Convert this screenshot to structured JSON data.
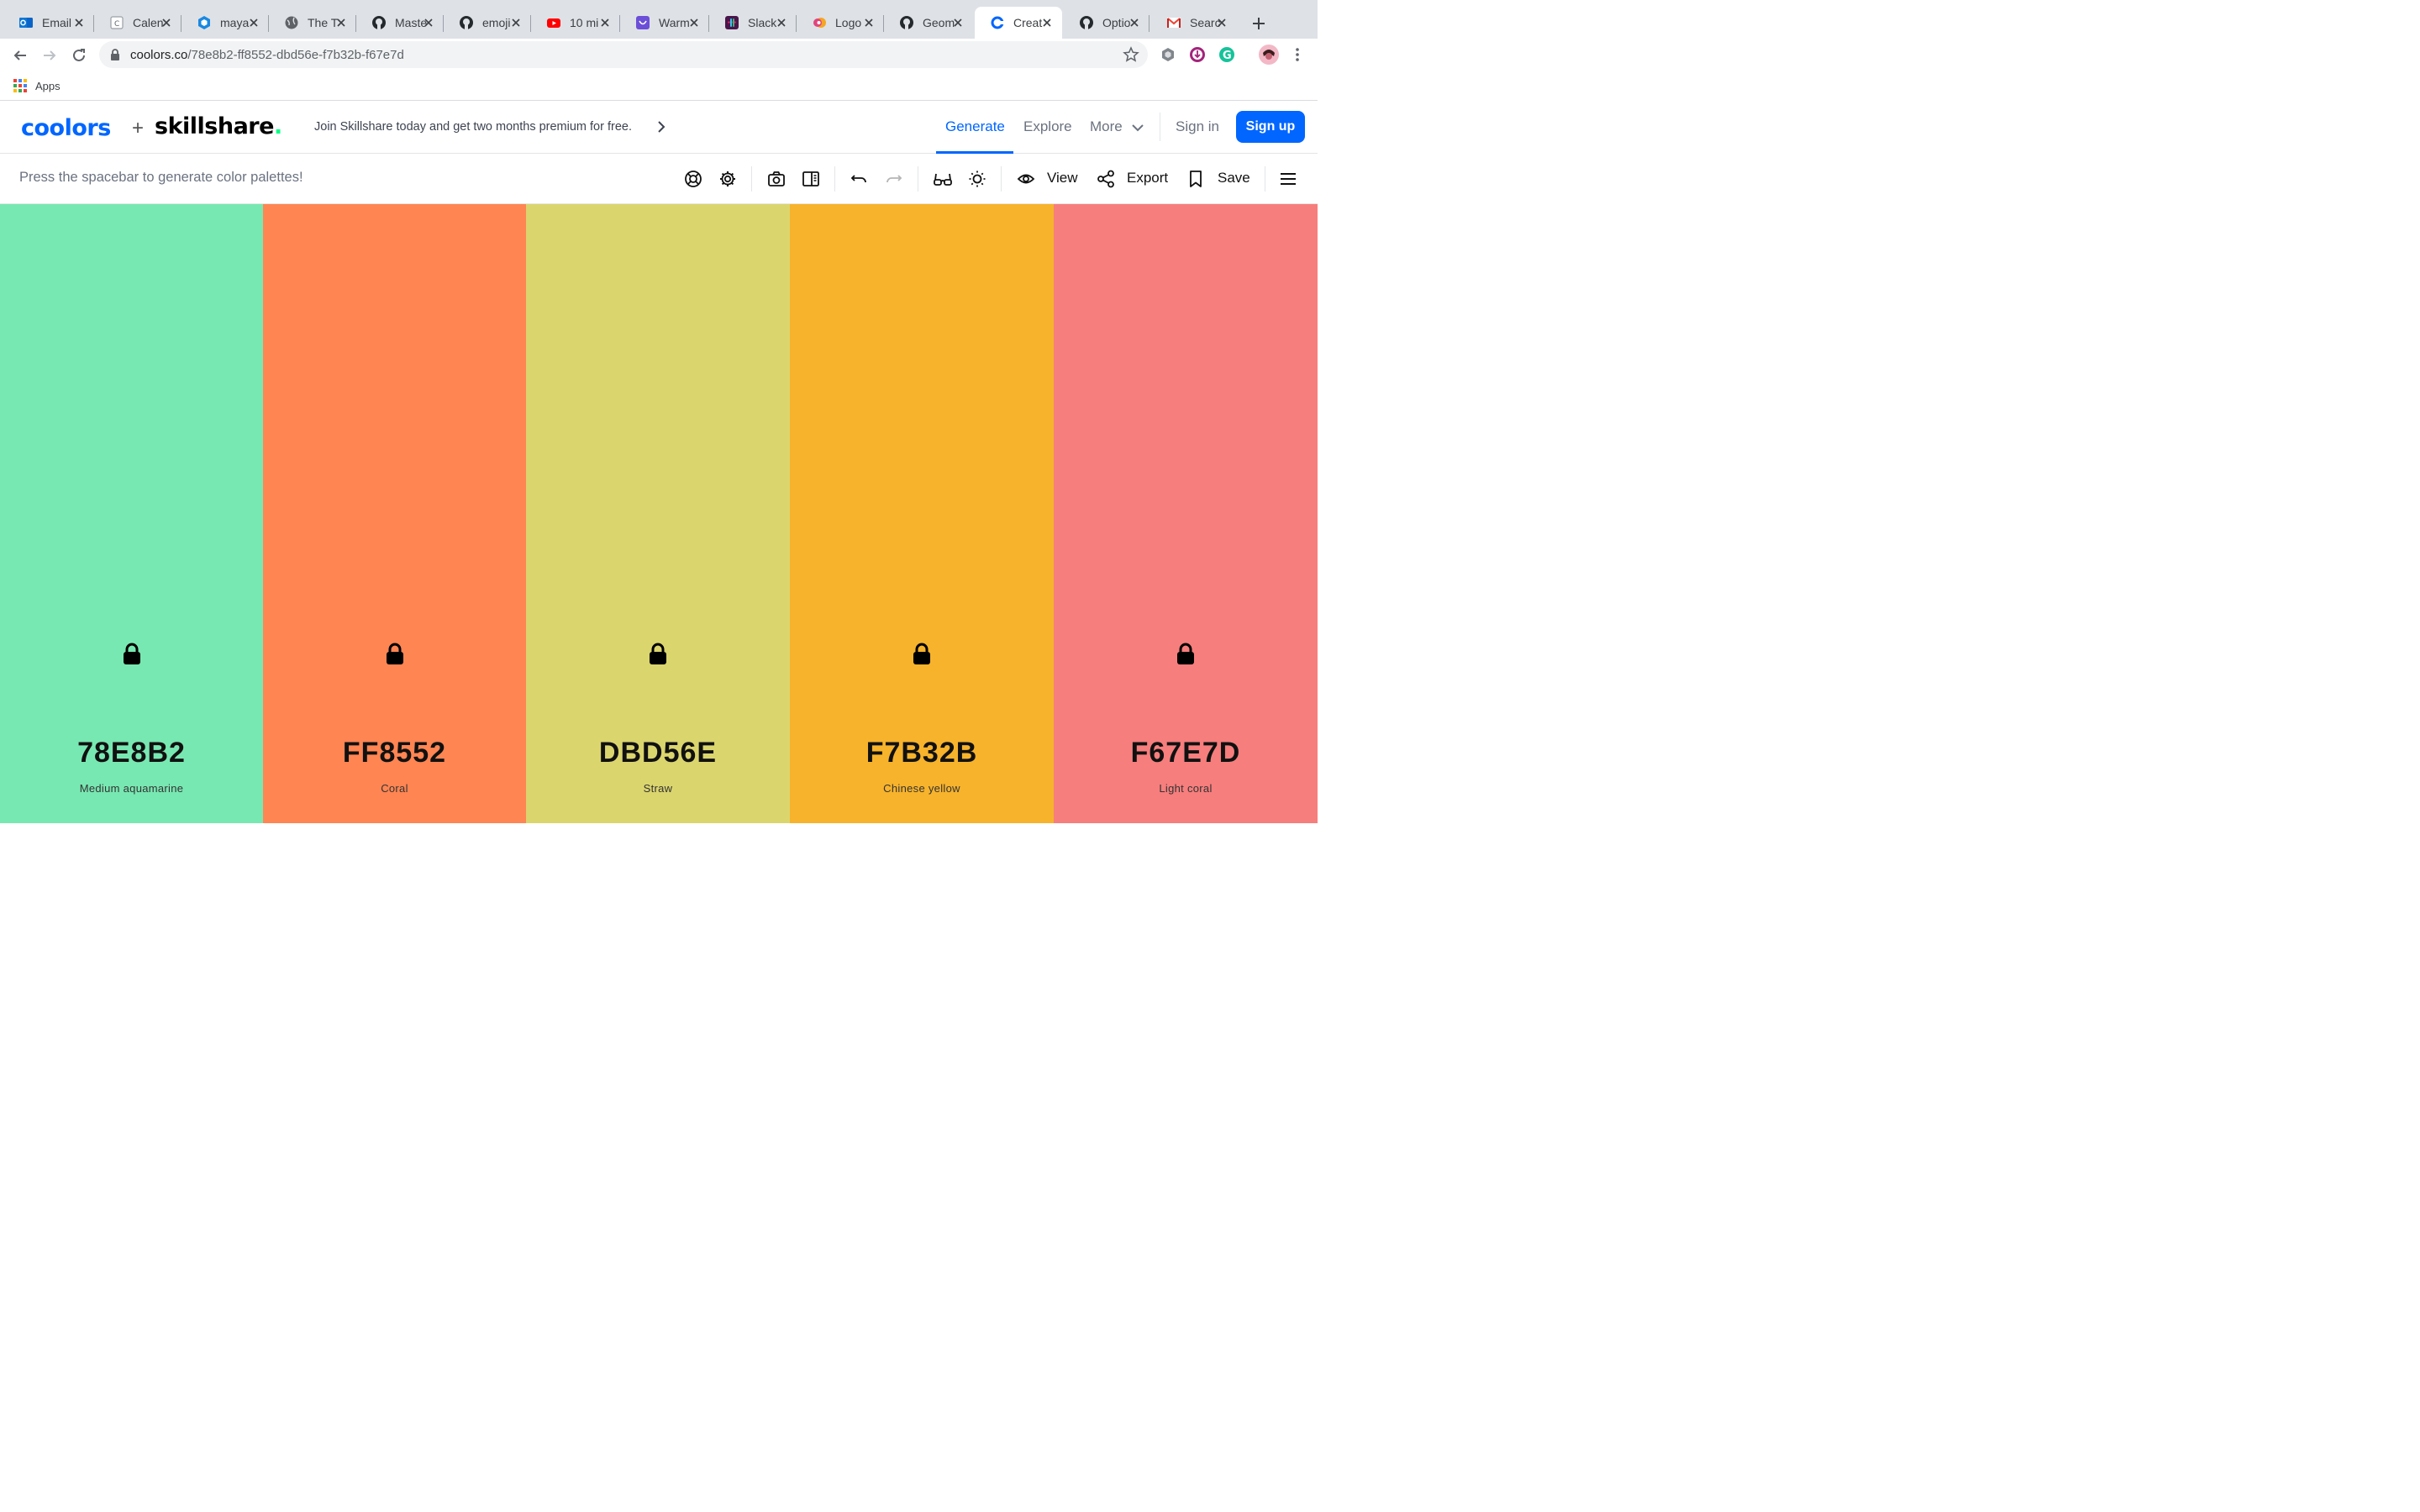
{
  "browser": {
    "tabs": [
      {
        "label": "Email",
        "icon": "outlook-icon",
        "active": false
      },
      {
        "label": "Calen",
        "icon": "calendar-icon",
        "active": false
      },
      {
        "label": "maya",
        "icon": "cube-icon",
        "active": false
      },
      {
        "label": "The T",
        "icon": "globe-icon",
        "active": false
      },
      {
        "label": "Maste",
        "icon": "github-icon",
        "active": false
      },
      {
        "label": "emoji",
        "icon": "github-icon",
        "active": false
      },
      {
        "label": "10 mi",
        "icon": "youtube-icon",
        "active": false
      },
      {
        "label": "Warm",
        "icon": "purple-app-icon",
        "active": false
      },
      {
        "label": "Slack",
        "icon": "slack-icon",
        "active": false
      },
      {
        "label": "Logo",
        "icon": "logo-icon",
        "active": false
      },
      {
        "label": "Geom",
        "icon": "github-icon",
        "active": false
      },
      {
        "label": "Creat",
        "icon": "coolors-icon",
        "active": true
      },
      {
        "label": "Optio",
        "icon": "github-icon",
        "active": false
      },
      {
        "label": "Searc",
        "icon": "gmail-icon",
        "active": false
      }
    ],
    "url_host": "coolors.co",
    "url_path": "/78e8b2-ff8552-dbd56e-f7b32b-f67e7d",
    "bookmarks_apps_label": "Apps"
  },
  "header": {
    "logo_text": "coolors",
    "plus": "+",
    "partner_text": "skillshare",
    "partner_dot": ".",
    "promo": "Join Skillshare today and get two months premium for free.",
    "nav": {
      "generate": "Generate",
      "explore": "Explore",
      "more": "More",
      "sign_in": "Sign in",
      "sign_up": "Sign up"
    },
    "accent": "#0066ff"
  },
  "toolbar": {
    "hint": "Press the spacebar to generate color palettes!",
    "view_label": "View",
    "export_label": "Export",
    "save_label": "Save"
  },
  "palette": [
    {
      "hex": "78E8B2",
      "name": "Medium aquamarine",
      "color": "#78e8b2"
    },
    {
      "hex": "FF8552",
      "name": "Coral",
      "color": "#ff8552"
    },
    {
      "hex": "DBD56E",
      "name": "Straw",
      "color": "#dbd56e"
    },
    {
      "hex": "F7B32B",
      "name": "Chinese yellow",
      "color": "#f7b32b"
    },
    {
      "hex": "F67E7D",
      "name": "Light coral",
      "color": "#f67e7d"
    }
  ]
}
